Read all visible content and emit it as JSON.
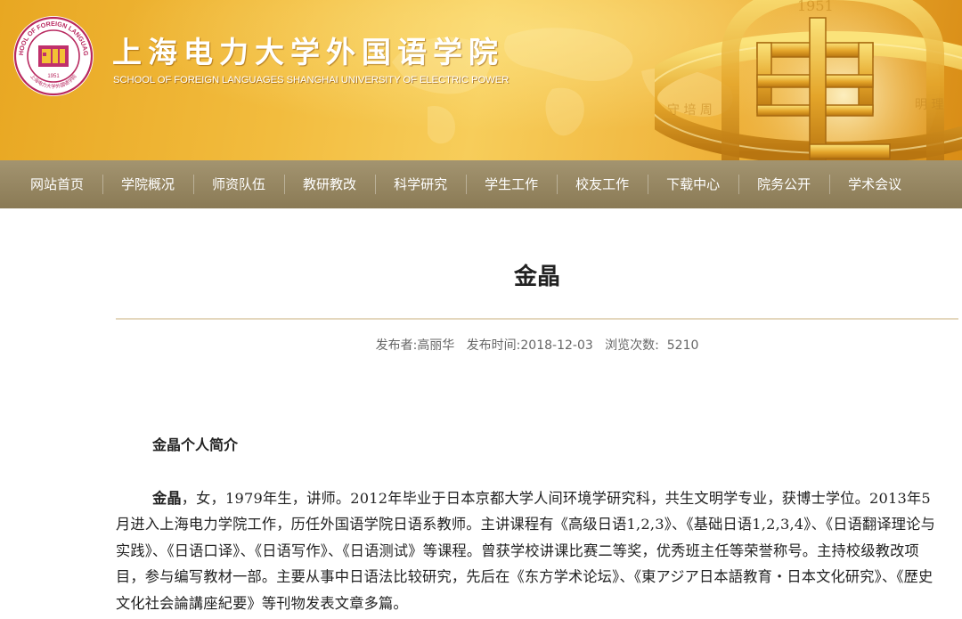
{
  "header": {
    "logo": {
      "ring_text": "SCHOOL OF FOREIGN LANGUAGES",
      "ring_text_cn": "上海电力大学外国语学院",
      "year": "1951"
    },
    "title_cn": "上海电力大学外国语学院",
    "title_en": "SCHOOL OF FOREIGN LANGUAGES SHANGHAI UNIVERSITY OF ELECTRIC POWER",
    "emblem_year": "1951",
    "colors": {
      "banner": "#f2bc3e",
      "nav": "#978761",
      "logo_accent": "#c0306b"
    }
  },
  "nav": {
    "items": [
      "网站首页",
      "学院概况",
      "师资队伍",
      "教研教改",
      "科学研究",
      "学生工作",
      "校友工作",
      "下载中心",
      "院务公开",
      "学术会议"
    ]
  },
  "article": {
    "title": "金晶",
    "meta": {
      "publisher_label": "发布者:",
      "publisher": "高丽华",
      "date_label": "发布时间:",
      "date": "2018-12-03",
      "views_label": "浏览次数:",
      "views": "5210"
    },
    "subheading": "金晶个人简介",
    "bio_name": "金晶",
    "bio_text": "，女，1979年生，讲师。2012年毕业于日本京都大学人间环境学研究科，共生文明学专业，获博士学位。2013年5月进入上海电力学院工作，历任外国语学院日语系教师。主讲课程有《高级日语1,2,3》、《基础日语1,2,3,4》、《日语翻译理论与实践》、《日语口译》、《日语写作》、《日语测试》等课程。曾获学校讲课比赛二等奖，优秀班主任等荣誉称号。主持校级教改项目，参与编写教材一部。主要从事中日语法比较研究，先后在《东方学术论坛》、《東アジア日本語教育・日本文化研究》、《歴史文化社会論講座紀要》等刊物发表文章多篇。"
  }
}
